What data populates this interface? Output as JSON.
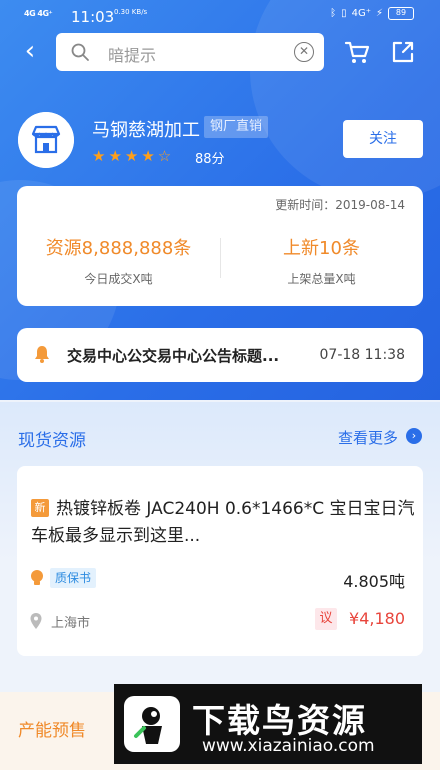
{
  "status_bar": {
    "signal": "4G 4G⁺",
    "time": "11:03",
    "speed": "0.30 KB/s",
    "network": "4G⁺",
    "battery": "89"
  },
  "navbar": {
    "search_placeholder": "暗提示",
    "icons": [
      "back-arrow-icon",
      "search-icon",
      "clear-icon",
      "cart-icon",
      "share-icon"
    ]
  },
  "shop": {
    "name": "马钢慈湖加工",
    "tag": "钢厂直销",
    "stars": "★★★★☆",
    "rating": "88分",
    "follow_label": "关注"
  },
  "stats": {
    "updated": "更新时间：2019-08-14",
    "resources_value": "资源8,888,888条",
    "resources_sub": "今日成交X吨",
    "new_value": "上新10条",
    "new_sub": "上架总量X吨"
  },
  "notice": {
    "text": "交易中心公交易中心公告标题...",
    "date": "07-18 11:38"
  },
  "spot": {
    "title": "现货资源",
    "more": "查看更多",
    "item": {
      "badge": "新",
      "title": "热镀锌板卷  JAC240H  0.6*1466*C 宝日宝日汽车板最多显示到这里...",
      "quality_badge": "质保书",
      "weight": "4.805吨",
      "location": "上海市",
      "negotiable": "议",
      "price": "¥4,180"
    }
  },
  "presale": {
    "title": "产能预售"
  },
  "watermark": {
    "title": "下载鸟资源",
    "url": "www.xiazainiao.com"
  },
  "colors": {
    "primary": "#2a6ee8",
    "orange": "#f08a2a",
    "red": "#e8453c",
    "star": "#ff9f1a"
  }
}
